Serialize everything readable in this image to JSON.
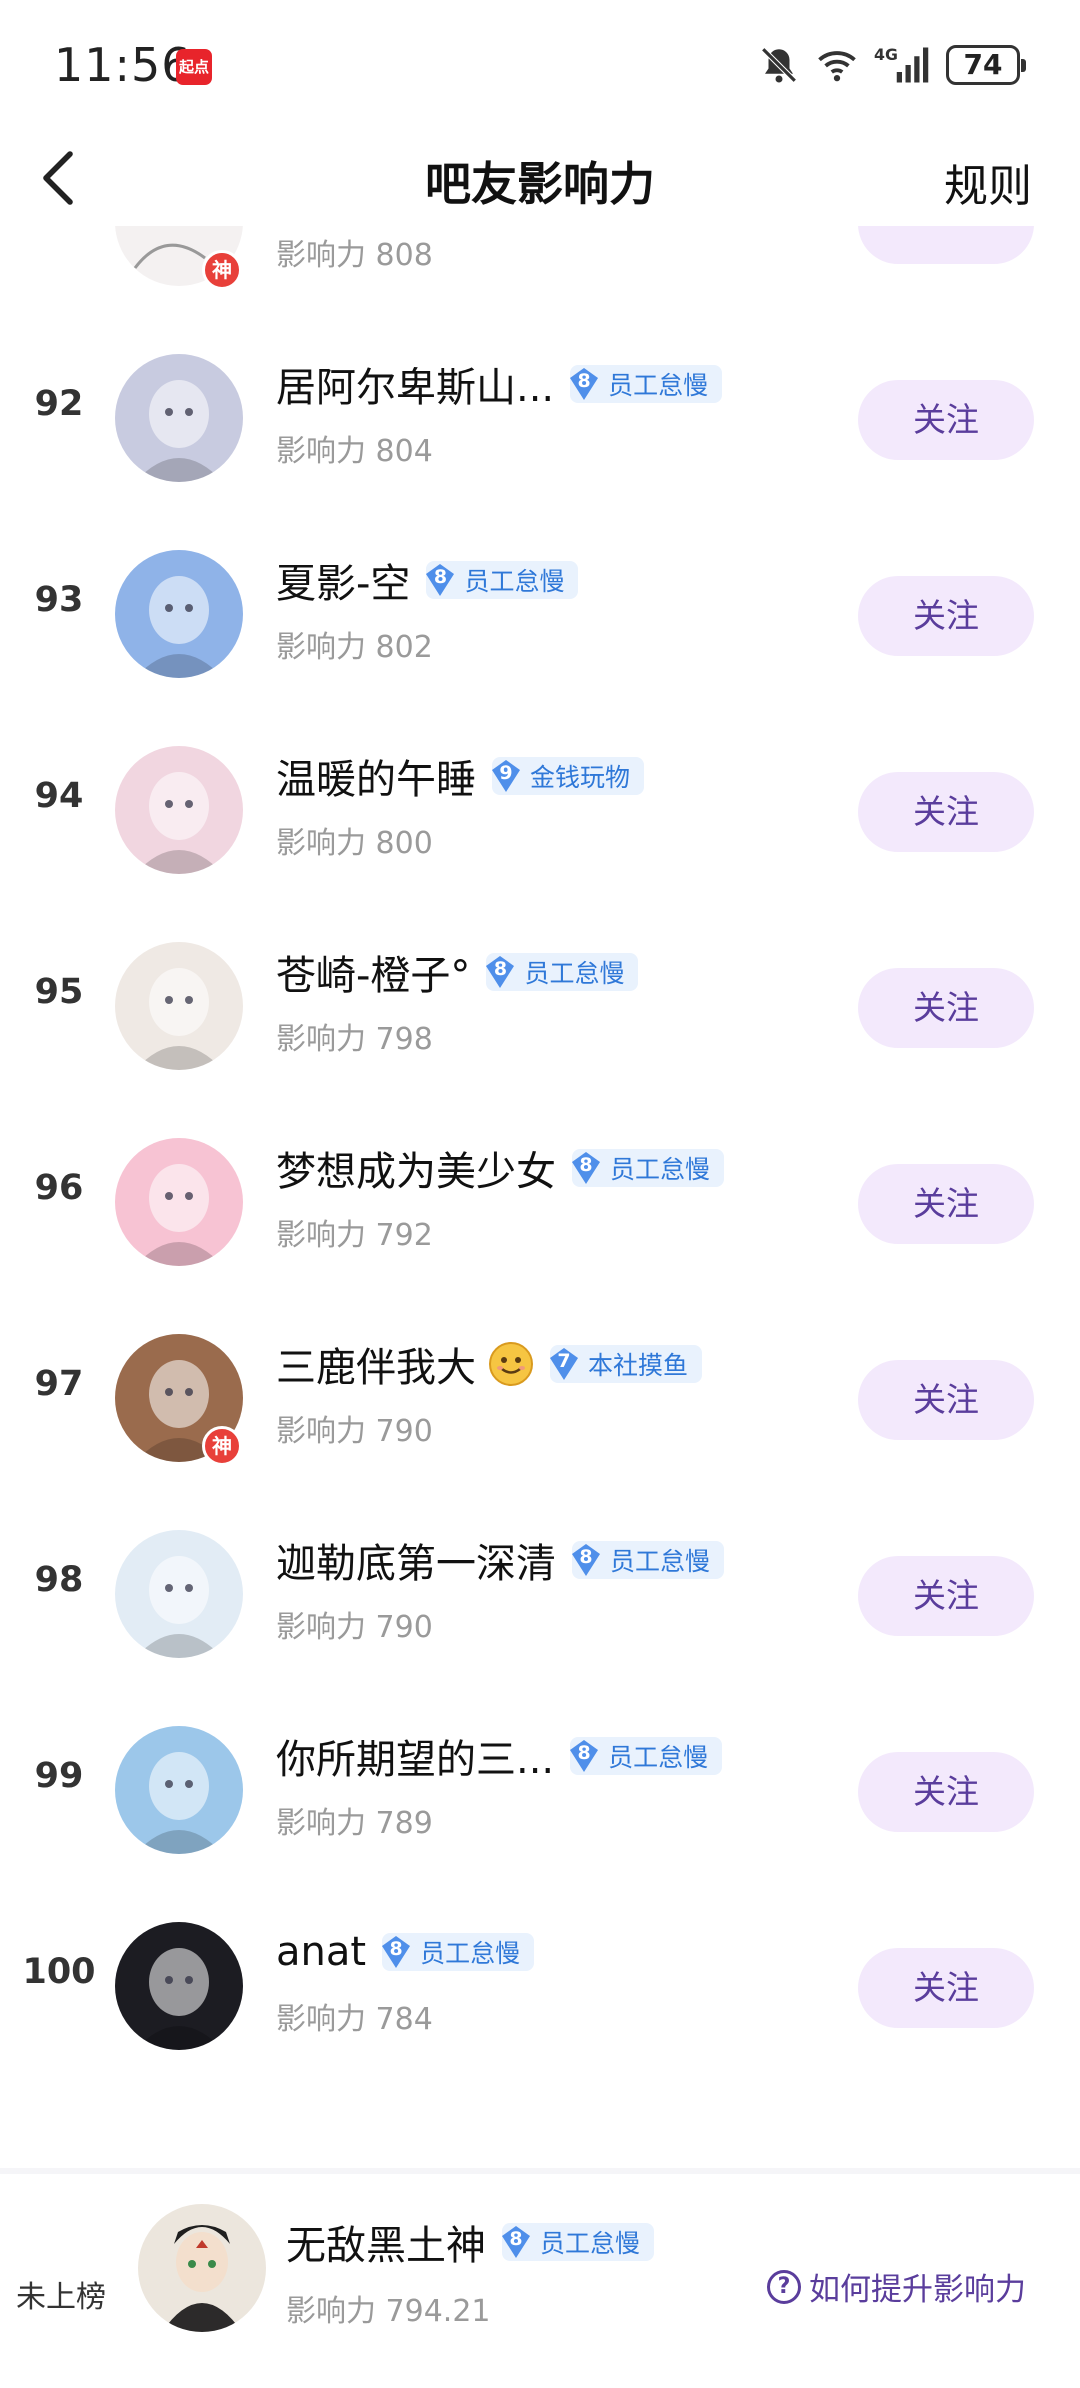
{
  "status_bar": {
    "time": "11:56",
    "app_badge": "起点",
    "battery": "74",
    "icons": [
      "mute-bell-icon",
      "wifi-icon",
      "signal-4g-icon",
      "battery-icon"
    ]
  },
  "header": {
    "title": "吧友影响力",
    "rules": "规则"
  },
  "partial_row": {
    "influence": "影响力 808"
  },
  "rows": [
    {
      "rank": "92",
      "name": "居阿尔卑斯山...",
      "level": "8",
      "badge": "员工怠慢",
      "influence": "影响力 804",
      "follow": "关注",
      "god": false,
      "emoji": false,
      "avatar_color": "#c8cbe0"
    },
    {
      "rank": "93",
      "name": "夏影-空",
      "level": "8",
      "badge": "员工怠慢",
      "influence": "影响力 802",
      "follow": "关注",
      "god": false,
      "emoji": false,
      "avatar_color": "#8fb3e8"
    },
    {
      "rank": "94",
      "name": "温暖的午睡",
      "level": "9",
      "badge": "金钱玩物",
      "influence": "影响力 800",
      "follow": "关注",
      "god": false,
      "emoji": false,
      "avatar_color": "#f1d6e0"
    },
    {
      "rank": "95",
      "name": "苍崎-橙子°",
      "level": "8",
      "badge": "员工怠慢",
      "influence": "影响力 798",
      "follow": "关注",
      "god": false,
      "emoji": false,
      "avatar_color": "#efe9e4"
    },
    {
      "rank": "96",
      "name": "梦想成为美少女",
      "level": "8",
      "badge": "员工怠慢",
      "influence": "影响力 792",
      "follow": "关注",
      "god": false,
      "emoji": false,
      "avatar_color": "#f7c3d3"
    },
    {
      "rank": "97",
      "name": "三鹿伴我大",
      "level": "7",
      "badge": "本社摸鱼",
      "influence": "影响力 790",
      "follow": "关注",
      "god": true,
      "emoji": true,
      "avatar_color": "#9a6b4d"
    },
    {
      "rank": "98",
      "name": "迦勒底第一深清",
      "level": "8",
      "badge": "员工怠慢",
      "influence": "影响力 790",
      "follow": "关注",
      "god": false,
      "emoji": false,
      "avatar_color": "#e2ecf5"
    },
    {
      "rank": "99",
      "name": "你所期望的三...",
      "level": "8",
      "badge": "员工怠慢",
      "influence": "影响力 789",
      "follow": "关注",
      "god": false,
      "emoji": false,
      "avatar_color": "#9cc7ea"
    },
    {
      "rank": "100",
      "name": "anat",
      "level": "8",
      "badge": "员工怠慢",
      "influence": "影响力 784",
      "follow": "关注",
      "god": false,
      "emoji": false,
      "avatar_color": "#1c1c22"
    }
  ],
  "god_label": "神",
  "bottom": {
    "label": "未上榜",
    "name": "无敌黑土神",
    "level": "8",
    "badge": "员工怠慢",
    "influence": "影响力 794.21",
    "howto": "如何提升影响力",
    "howto_icon": "?"
  },
  "colors": {
    "accent_purple": "#5a3d9c",
    "follow_bg": "#f3e9fc",
    "badge_bg": "#e9f2fd",
    "badge_text": "#2f78d8",
    "god_red": "#e8403a"
  }
}
